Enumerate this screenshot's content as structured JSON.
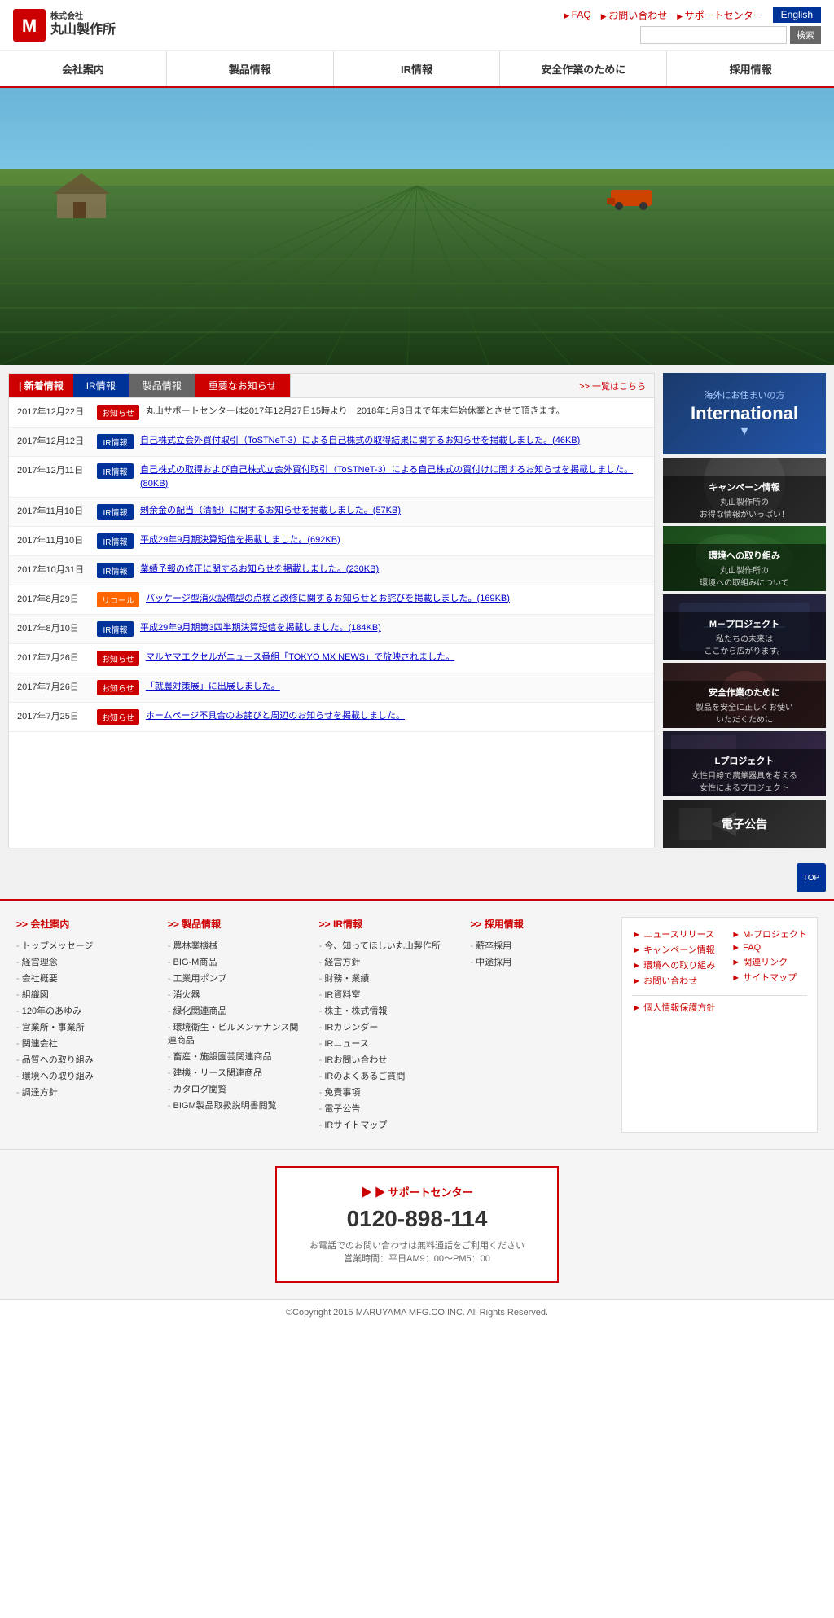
{
  "header": {
    "logo_text": "株式会社\n丸山製作所",
    "nav_faq": "FAQ",
    "nav_contact": "お問い合わせ",
    "nav_support": "サポートセンター",
    "english_label": "English",
    "search_placeholder": "",
    "search_button": "検索"
  },
  "main_nav": {
    "items": [
      {
        "label": "会社案内",
        "href": "#"
      },
      {
        "label": "製品情報",
        "href": "#"
      },
      {
        "label": "IR情報",
        "href": "#"
      },
      {
        "label": "安全作業のために",
        "href": "#"
      },
      {
        "label": "採用情報",
        "href": "#"
      }
    ]
  },
  "news_section": {
    "tab_new": "新着情報",
    "tab_ir": "IR情報",
    "tab_product": "製品情報",
    "tab_important": "重要なお知らせ",
    "all_link": "一覧はこちら",
    "items": [
      {
        "date": "2017年12月22日",
        "badge": "お知らせ",
        "badge_type": "info",
        "text": "丸山サポートセンターは2017年12月27日15時より　2018年1月3日まで年末年始休業とさせて頂きます。",
        "link": false
      },
      {
        "date": "2017年12月12日",
        "badge": "IR情報",
        "badge_type": "ir",
        "text": "自己株式立会外買付取引（ToSTNeT-3）による自己株式の取得結果に関するお知らせを掲載しました。(46KB)",
        "link": true
      },
      {
        "date": "2017年12月11日",
        "badge": "IR情報",
        "badge_type": "ir",
        "text": "自己株式の取得および自己株式立会外買付取引（ToSTNeT-3）による自己株式の買付けに関するお知らせを掲載しました。(80KB)",
        "link": true
      },
      {
        "date": "2017年11月10日",
        "badge": "IR情報",
        "badge_type": "ir",
        "text": "剰余金の配当（清配）に関するお知らせを掲載しました。(57KB)",
        "link": true
      },
      {
        "date": "2017年11月10日",
        "badge": "IR情報",
        "badge_type": "ir",
        "text": "平成29年9月期決算短信を掲載しました。(692KB)",
        "link": true
      },
      {
        "date": "2017年10月31日",
        "badge": "IR情報",
        "badge_type": "ir",
        "text": "業績予報の修正に関するお知らせを掲載しました。(230KB)",
        "link": true
      },
      {
        "date": "2017年8月29日",
        "badge": "リコール",
        "badge_type": "recall",
        "text": "パッケージ型消火設備型の点検と改修に関するお知らせとお詫びを掲載しました。(169KB)",
        "link": true
      },
      {
        "date": "2017年8月10日",
        "badge": "IR情報",
        "badge_type": "ir",
        "text": "平成29年9月期第3四半期決算短信を掲載しました。(184KB)",
        "link": true
      },
      {
        "date": "2017年7月26日",
        "badge": "お知らせ",
        "badge_type": "info",
        "text": "マルヤマエクセルがニュース番組「TOKYO MX NEWS」で放映されました。",
        "link": true
      },
      {
        "date": "2017年7月26日",
        "badge": "お知らせ",
        "badge_type": "info",
        "text": "「就農対策展」に出展しました。",
        "link": true
      },
      {
        "date": "2017年7月25日",
        "badge": "お知らせ",
        "badge_type": "info",
        "text": "ホームページ不具合のお詫びと周辺のお知らせを掲載しました。",
        "link": true
      }
    ]
  },
  "sidebar": {
    "international": {
      "subtitle": "海外にお住まいの方",
      "title": "International",
      "arrow": "▼"
    },
    "campaign": {
      "label": "キャンペーン情報",
      "sublabel": "丸山製作所の\nお得な情報がいっぱい！"
    },
    "environment": {
      "label": "環境への取り組み",
      "sublabel": "丸山製作所の\n環境への取組みについて"
    },
    "m_project": {
      "label": "M－プロジェクト",
      "sublabel": "私たちの未来は\nここから広がります。"
    },
    "safety": {
      "label": "安全作業のために",
      "sublabel": "製品を安全に正しくお使い\nいただくために"
    },
    "l_project": {
      "label": "Lプロジェクト",
      "sublabel": "女性目線で農業器具を考える\n女性によるプロジェクト"
    },
    "denshi": {
      "label": "電子公告"
    }
  },
  "back_to_top": "TOP",
  "footer_nav": {
    "company": {
      "title": "会社案内",
      "items": [
        "トップメッセージ",
        "経営理念",
        "会社概要",
        "組織図",
        "120年のあゆみ",
        "営業所・事業所",
        "関連会社",
        "品質への取り組み",
        "環境への取り組み",
        "調達方針"
      ]
    },
    "product": {
      "title": "製品情報",
      "items": [
        "農林業機械",
        "BIG-M商品",
        "工業用ポンプ",
        "消火器",
        "緑化関連商品",
        "環境衛生・ビルメンテナンス関連商品",
        "畜産・施設園芸関連商品",
        "建機・リース関連商品",
        "カタログ閲覧",
        "BIGM製品取扱説明書閲覧"
      ]
    },
    "ir": {
      "title": "IR情報",
      "items": [
        "今、知ってほしい丸山製作所",
        "経営方針",
        "財務・業績",
        "IR資料室",
        "株主・株式情報",
        "IRカレンダー",
        "IRニュース",
        "IRお問い合わせ",
        "IRのよくあるご質問",
        "免責事項",
        "電子公告",
        "IRサイトマップ"
      ]
    },
    "recruit": {
      "title": "採用情報",
      "items": [
        "薪卒採用",
        "中途採用"
      ]
    }
  },
  "footer_sub": {
    "links_left": [
      "ニュースリリース",
      "キャンペーン情報",
      "環境への取り組み",
      "お問い合わせ",
      "個人情報保護方針"
    ],
    "links_right": [
      "M-プロジェクト",
      "FAQ",
      "関連リンク",
      "サイトマップ"
    ]
  },
  "support": {
    "title": "サポートセンター",
    "phone": "0120-898-114",
    "note1": "お電話でのお問い合わせは無料通話をご利用ください",
    "note2": "営業時間：平日AM9：00〜PM5：00"
  },
  "footer_bottom": {
    "copyright": "©Copyright 2015 MARUYAMA MFG.CO.INC. All Rights Reserved."
  }
}
